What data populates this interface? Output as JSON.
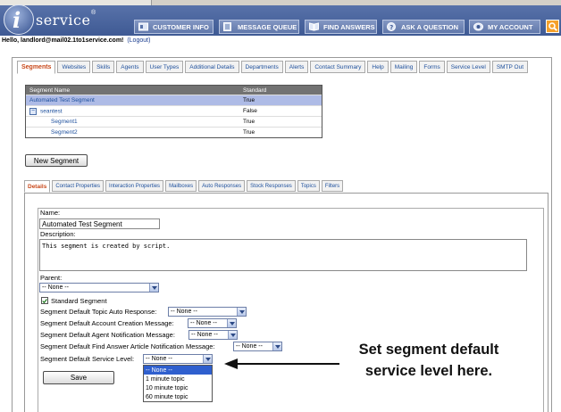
{
  "header": {
    "logo_text": "service",
    "logo_letter": "i",
    "logo_mark": "®",
    "nav": [
      {
        "label": "CUSTOMER INFO",
        "icon": "customer-info-icon"
      },
      {
        "label": "MESSAGE QUEUE",
        "icon": "message-queue-icon"
      },
      {
        "label": "FIND ANSWERS",
        "icon": "book-icon"
      },
      {
        "label": "ASK A QUESTION",
        "icon": "question-icon"
      },
      {
        "label": "MY ACCOUNT",
        "icon": "eye-icon"
      }
    ]
  },
  "user": {
    "greeting": "Hello, landlord@mail02.1to1service.com!",
    "logout": "(Logout)"
  },
  "top_tabs": [
    "Segments",
    "Websites",
    "Skills",
    "Agents",
    "User Types",
    "Additional Details",
    "Departments",
    "Alerts",
    "Contact Summary",
    "Help",
    "Mailing",
    "Forms",
    "Service Level",
    "SMTP Out"
  ],
  "segment_table": {
    "columns": [
      "Segment Name",
      "Standard"
    ],
    "rows": [
      {
        "name": "Automated Test Segment",
        "standard": "True"
      },
      {
        "name": "seantest",
        "standard": "False"
      },
      {
        "name": "Segment1",
        "standard": "True"
      },
      {
        "name": "Segment2",
        "standard": "True"
      }
    ],
    "expander": "−"
  },
  "new_segment_label": "New Segment",
  "sub_tabs": [
    "Details",
    "Contact Properties",
    "Interaction Properties",
    "Mailboxes",
    "Auto Responses",
    "Stock Responses",
    "Topics",
    "Filters"
  ],
  "form": {
    "name_label": "Name:",
    "name_value": "Automated Test Segment",
    "description_label": "Description:",
    "description_value": "This segment is created by script.",
    "parent_label": "Parent:",
    "parent_value": "-- None --",
    "standard_label": "Standard Segment",
    "topic_auto_response_label": "Segment Default Topic Auto Response:",
    "topic_auto_response_value": "-- None --",
    "account_creation_label": "Segment Default Account Creation Message:",
    "account_creation_value": "-- None --",
    "agent_notification_label": "Segment Default Agent Notification Message:",
    "agent_notification_value": "-- None --",
    "find_answer_label": "Segment Default Find Answer Article Notification Message:",
    "find_answer_value": "-- None --",
    "service_level_label": "Segment Default Service Level:",
    "service_level_value": "-- None --",
    "service_level_options": [
      "-- None --",
      "1 minute topic",
      "10 minute topic",
      "60 minute topic"
    ],
    "save_label": "Save"
  },
  "callout": {
    "line1": "Set segment default",
    "line2": "service level here."
  },
  "colors": {
    "banner": "#4a65a0",
    "active_tab": "#c8481a",
    "link": "#1d4f9c",
    "selected_row": "#aebbe6",
    "dropdown_highlight": "#2f5fce"
  }
}
